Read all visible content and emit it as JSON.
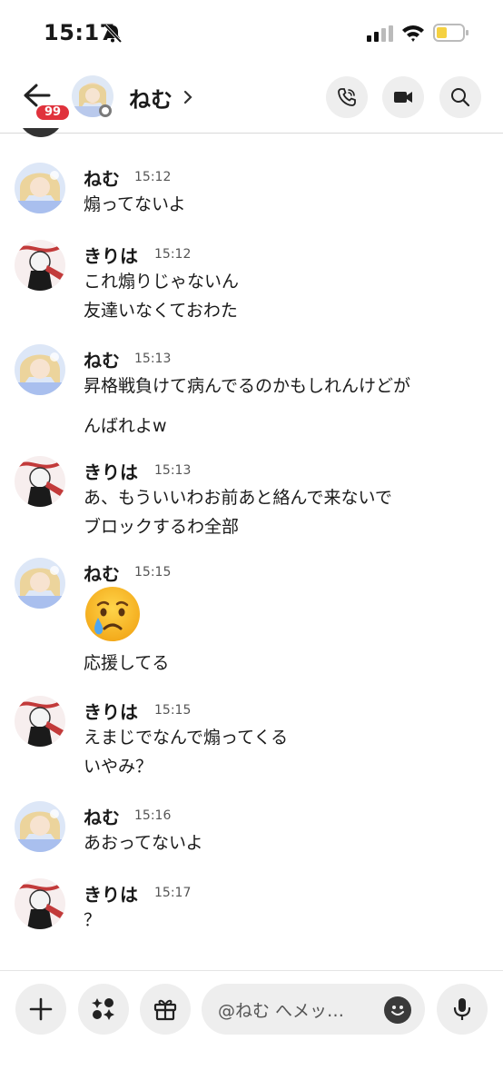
{
  "status_bar": {
    "time": "15:17"
  },
  "header": {
    "unread_count": "99",
    "chat_name": "ねむ"
  },
  "messages": [
    {
      "sender": "ねむ",
      "time": "15:12",
      "lines": [
        "煽ってないよ"
      ]
    },
    {
      "sender": "きりは",
      "time": "15:12",
      "lines": [
        "これ煽りじゃないん",
        "友達いなくておわた"
      ]
    },
    {
      "sender": "ねむ",
      "time": "15:13",
      "lines": [
        "昇格戦負けて病んでるのかもしれんけどが",
        "んばれよw"
      ]
    },
    {
      "sender": "きりは",
      "time": "15:13",
      "lines": [
        "あ、もういいわお前あと絡んで来ないで",
        "ブロックするわ全部"
      ]
    },
    {
      "sender": "ねむ",
      "time": "15:15",
      "emoji": "crying-face",
      "lines": [
        "応援してる"
      ]
    },
    {
      "sender": "きりは",
      "time": "15:15",
      "lines": [
        "えまじでなんで煽ってくる",
        "いやみ？"
      ]
    },
    {
      "sender": "ねむ",
      "time": "15:16",
      "lines": [
        "あおってないよ"
      ]
    },
    {
      "sender": "きりは",
      "time": "15:17",
      "lines": [
        "？"
      ]
    }
  ],
  "composer": {
    "placeholder": "@ねむ へメッ…"
  },
  "colors": {
    "badge": "#e0323c",
    "button_bg": "#eeeeee",
    "battery_fill": "#f5d142"
  },
  "icons": [
    "bell-slash-icon",
    "signal-icon",
    "wifi-icon",
    "battery-icon",
    "back-arrow-icon",
    "phone-icon",
    "video-icon",
    "search-icon",
    "plus-icon",
    "sticker-icon",
    "gift-icon",
    "emoji-icon",
    "mic-icon"
  ]
}
